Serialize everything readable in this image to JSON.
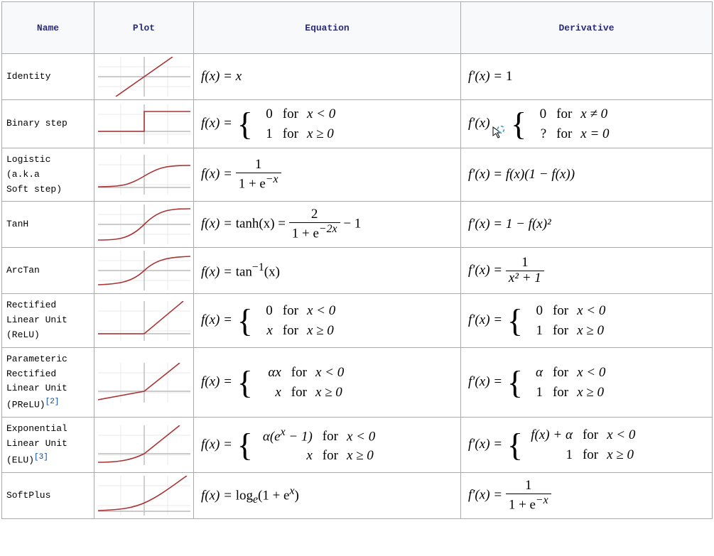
{
  "headers": {
    "name": "Name",
    "plot": "Plot",
    "equation": "Equation",
    "derivative": "Derivative"
  },
  "rows": {
    "identity": {
      "name": "Identity"
    },
    "binarystep": {
      "name": "Binary step"
    },
    "logistic": {
      "name": "Logistic (a.k.a\nSoft step)"
    },
    "tanh": {
      "name": "TanH"
    },
    "arctan": {
      "name": "ArcTan"
    },
    "relu": {
      "name": "Rectified\nLinear Unit\n(ReLU)"
    },
    "prelu": {
      "name": "Parameteric\nRectified\nLinear Unit\n(PReLU)",
      "ref": "[2]"
    },
    "elu": {
      "name": "Exponential\nLinear Unit\n(ELU)",
      "ref": "[3]"
    },
    "softplus": {
      "name": "SoftPlus"
    }
  },
  "math": {
    "fx": "f(x) = ",
    "fpx": "f′(x) = ",
    "fpx_cursor": "f′(x)",
    "x": "x",
    "one": "1",
    "zero": "0",
    "alpha": "α",
    "q": "?",
    "for": "for",
    "xlt0": "x < 0",
    "xge0": "x ≥ 0",
    "xne0": "x ≠ 0",
    "xeq0": "x = 0",
    "logistic_den": "1 + e",
    "neg_x": "−x",
    "neg_2x": "−2x",
    "tanh": "tanh(x) = ",
    "two": "2",
    "minus1": " − 1",
    "arctan": "tan",
    "inv": "−1",
    "arctan_arg": "(x)",
    "arctan_d_num": "1",
    "arctan_d_den": "x² + 1",
    "ax": "αx",
    "elu_a": "α(e",
    "elu_sup": "x",
    "elu_b": " − 1)",
    "elu_d": "f(x) + α",
    "softplus": "log",
    "softplus_sub": "e",
    "softplus_arg": "(1 + e",
    "softplus_sup": "x",
    "softplus_close": ")",
    "logistic_d": "f(x)(1 − f(x))",
    "tanh_d": "1 − f(x)²"
  },
  "chart_data": [
    {
      "type": "line",
      "name": "Identity",
      "x": [
        -3,
        3
      ],
      "y": [
        -3,
        3
      ],
      "xlim": [
        -3,
        3
      ],
      "ylim": [
        -3,
        3
      ]
    },
    {
      "type": "line",
      "name": "Binary step",
      "segments": [
        {
          "x": [
            -3,
            0
          ],
          "y": [
            0,
            0
          ]
        },
        {
          "x": [
            0,
            3
          ],
          "y": [
            1,
            1
          ]
        }
      ],
      "xlim": [
        -3,
        3
      ],
      "ylim": [
        -1,
        2
      ]
    },
    {
      "type": "line",
      "name": "Logistic",
      "x": [
        -6,
        -4,
        -2,
        0,
        2,
        4,
        6
      ],
      "y": [
        0.0025,
        0.018,
        0.119,
        0.5,
        0.881,
        0.982,
        0.9975
      ],
      "xlim": [
        -6,
        6
      ],
      "ylim": [
        0,
        1
      ]
    },
    {
      "type": "line",
      "name": "TanH",
      "x": [
        -3,
        -2,
        -1,
        0,
        1,
        2,
        3
      ],
      "y": [
        -0.995,
        -0.964,
        -0.762,
        0,
        0.762,
        0.964,
        0.995
      ],
      "xlim": [
        -3,
        3
      ],
      "ylim": [
        -1,
        1
      ]
    },
    {
      "type": "line",
      "name": "ArcTan",
      "x": [
        -6,
        -3,
        -1,
        0,
        1,
        3,
        6
      ],
      "y": [
        -1.406,
        -1.249,
        -0.785,
        0,
        0.785,
        1.249,
        1.406
      ],
      "xlim": [
        -6,
        6
      ],
      "ylim": [
        -1.6,
        1.6
      ]
    },
    {
      "type": "line",
      "name": "ReLU",
      "segments": [
        {
          "x": [
            -3,
            0
          ],
          "y": [
            0,
            0
          ]
        },
        {
          "x": [
            0,
            3
          ],
          "y": [
            0,
            3
          ]
        }
      ],
      "xlim": [
        -3,
        3
      ],
      "ylim": [
        -1,
        3
      ]
    },
    {
      "type": "line",
      "name": "PReLU",
      "segments": [
        {
          "x": [
            -3,
            0
          ],
          "y": [
            -0.9,
            0
          ]
        },
        {
          "x": [
            0,
            3
          ],
          "y": [
            0,
            3
          ]
        }
      ],
      "xlim": [
        -3,
        3
      ],
      "ylim": [
        -1,
        3
      ]
    },
    {
      "type": "line",
      "name": "ELU",
      "segments": [
        {
          "x": [
            -3,
            -2,
            -1,
            0
          ],
          "y": [
            -0.95,
            -0.865,
            -0.632,
            0
          ]
        },
        {
          "x": [
            0,
            3
          ],
          "y": [
            0,
            3
          ]
        }
      ],
      "xlim": [
        -3,
        3
      ],
      "ylim": [
        -1,
        3
      ]
    },
    {
      "type": "line",
      "name": "SoftPlus",
      "x": [
        -3,
        -2,
        -1,
        0,
        1,
        2,
        3
      ],
      "y": [
        0.049,
        0.127,
        0.313,
        0.693,
        1.313,
        2.127,
        3.049
      ],
      "xlim": [
        -3,
        3
      ],
      "ylim": [
        0,
        3.2
      ]
    }
  ]
}
